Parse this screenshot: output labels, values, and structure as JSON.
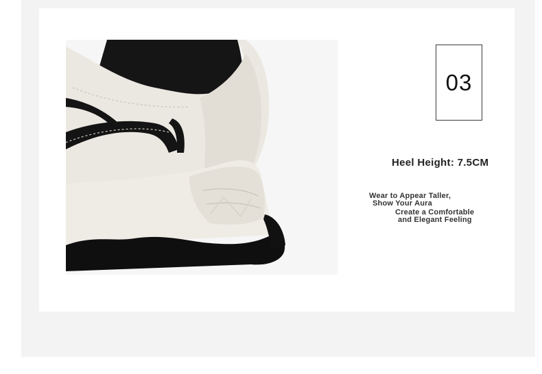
{
  "index_number": "03",
  "heel_height": "Heel Height: 7.5CM",
  "description": {
    "line1": "Wear to Appear Taller,",
    "line2": "Show Your Aura",
    "line3": "Create a Comfortable",
    "line4": "and Elegant Feeling"
  },
  "photo": {
    "subject": "sneaker-heel-closeup",
    "colors": {
      "upper": "#e9e6df",
      "accent": "#111111",
      "sole": "#ece9e2",
      "outsole": "#0d0d0d"
    }
  }
}
